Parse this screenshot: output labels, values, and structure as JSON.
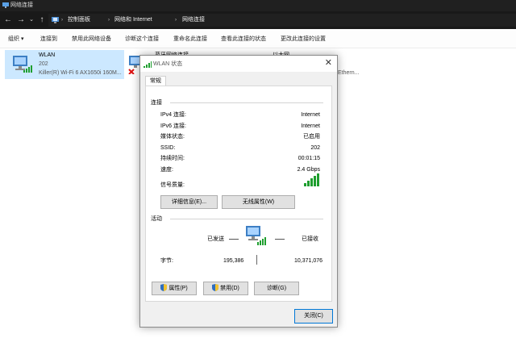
{
  "window": {
    "title": "网络连接"
  },
  "breadcrumbs": [
    "控制面板",
    "网络和 Internet",
    "网络连接"
  ],
  "toolbar": {
    "items": [
      "组织 ▾",
      "连接到",
      "禁用此网络设备",
      "诊断这个连接",
      "重命名此连接",
      "查看此连接的状态",
      "更改此连接的设置"
    ]
  },
  "adapters": [
    {
      "name": "WLAN",
      "status": "202",
      "device": "Killer(R) Wi-Fi 6 AX1650i 160M...",
      "icon": "wifi-adapter-icon"
    },
    {
      "name": "蓝牙网络连接",
      "status": "",
      "device": "",
      "icon": "bluetooth-adapter-icon"
    },
    {
      "name": "以太网",
      "status": "",
      "device": "Ethern...",
      "icon": "ethernet-adapter-icon"
    }
  ],
  "dialog": {
    "title": "WLAN 状态",
    "tab": "常规",
    "connection": {
      "label": "连接",
      "rows": [
        {
          "key": "IPv4 连接:",
          "value": "Internet"
        },
        {
          "key": "IPv6 连接:",
          "value": "Internet"
        },
        {
          "key": "媒体状态:",
          "value": "已启用"
        },
        {
          "key": "SSID:",
          "value": "202"
        },
        {
          "key": "持续时间:",
          "value": "00:01:15"
        },
        {
          "key": "速度:",
          "value": "2.4 Gbps"
        }
      ],
      "signal_label": "信号质量:",
      "signal_bars": 5
    },
    "buttons": {
      "details": "详细信息(E)...",
      "wireless": "无线属性(W)"
    },
    "activity": {
      "label": "活动",
      "sent_label": "已发送",
      "received_label": "已接收",
      "bytes_label": "字节:",
      "bytes_sent": "195,386",
      "bytes_received": "10,371,076"
    },
    "footer_buttons": {
      "properties": "属性(P)",
      "disable": "禁用(D)",
      "diagnose": "诊断(G)"
    },
    "close_button": "关闭(C)"
  },
  "colors": {
    "selection": "#cce8ff",
    "signal": "#1e9e2e",
    "accent": "#0078d7"
  }
}
